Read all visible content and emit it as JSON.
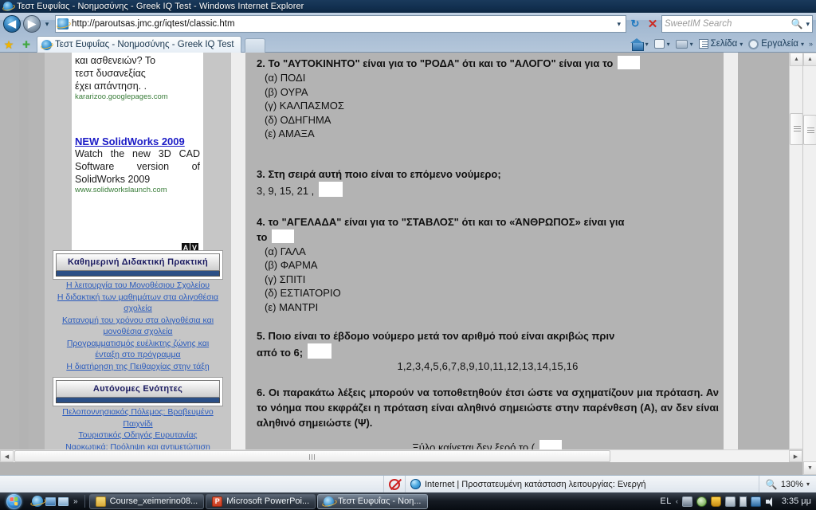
{
  "window": {
    "title": "Τεστ Ευφυΐας - Νοημοσύνης - Greek IQ Test - Windows Internet Explorer",
    "icon": "ie-logo-icon"
  },
  "address_bar": {
    "url": "http://paroutsas.jmc.gr/iqtest/classic.htm",
    "back_label": "◀",
    "forward_label": "▶",
    "history_caret": "▾",
    "go_label": "→",
    "refresh_label": "↻",
    "stop_label": "✕",
    "dropdown_caret": "▾"
  },
  "search": {
    "placeholder": "SweetIM Search",
    "magnifier": "search-icon",
    "caret": "▾"
  },
  "tabs": {
    "favorites_star": "★",
    "add_favorite": "✚",
    "items": [
      {
        "label": "Τεστ Ευφυΐας - Νοημοσύνης - Greek IQ Test",
        "active": true
      }
    ],
    "new_tab_label": ""
  },
  "command_bar": {
    "home": "",
    "feeds": "",
    "print": "",
    "page": "Σελίδα",
    "tools": "Εργαλεία",
    "overflow": "»",
    "caret": "▾"
  },
  "sidebar": {
    "ad": {
      "text_lines": [
        "και ασθενειών? Το",
        "τεστ δυσανεξίας",
        "έχει απάντηση. ."
      ],
      "url1": "kararizoo.googlepages.com",
      "headline": "NEW SolidWorks 2009",
      "description": "Watch the new 3D CAD Software version of SolidWorks 2009",
      "url2": "www.solidworkslaunch.com",
      "badge_a": "A",
      "badge_v": "V"
    },
    "sections": [
      {
        "header": "Καθημερινή Διδακτική  Πρακτική",
        "links": [
          "Η λειτουργία του Μονοθέσιου Σχολείου",
          "Η διδακτική των μαθημάτων στα ολιγοθέσια σχολεία",
          "Κατανομή του χρόνου στα ολιγοθέσια και μονοθέσια σχολεία",
          "Προγραμματισμός ευέλικτης ζώνης και ένταξη στο πρόγραμμα",
          "Η διατήρηση της Πειθαρχίας στην τάξη"
        ]
      },
      {
        "header": "Αυτόνομες  Ενότητες",
        "links": [
          "Πελοποννησιακός Πόλεμος:  Βραβευμένο Παιχνίδι",
          "Τουριστικός Οδηγός Ευρυτανίας",
          "Ναρκωτικά: Πρόληψη και αντιμετώπιση"
        ]
      }
    ]
  },
  "quiz": {
    "questions": [
      {
        "number": "2.",
        "text": "Το \"ΑΥΤΟΚΙΝΗΤΟ\" είναι για το \"ΡΟΔΑ\" ότι και το \"ΑΛΟΓΟ\" είναι για το",
        "answer_value": "",
        "options": [
          "(α) ΠΟΔΙ",
          "(β) ΟΥΡΑ",
          "(γ)  ΚΑΛΠΑΣΜΟΣ",
          "(δ) ΟΔΗΓΗΜΑ",
          "(ε) ΑΜΑΞΑ"
        ]
      },
      {
        "number": "3.",
        "text": "Στη σειρά αυτή ποιο είναι το επόμενο νούμερο;",
        "sequence": "3, 9, 15, 21 ,",
        "answer_value": "",
        "options": []
      },
      {
        "number": "4.",
        "text": "το \"ΑΓΕΛΑΔΑ\" είναι για το \"ΣΤΑΒΛΟΣ\" ότι και το «ΆΝΘΡΩΠΟΣ» είναι για",
        "text_cont": "το",
        "answer_value": "",
        "options": [
          "(α) ΓΑΛΑ",
          "(β) ΦΑΡΜΑ",
          "(γ) ΣΠΙΤΙ",
          "(δ) ΕΣΤΙΑΤΟΡΙΟ",
          "(ε) ΜΑΝΤΡΙ"
        ]
      },
      {
        "number": "5.",
        "text": "Ποιο είναι το έβδομο νούμερο μετά τον αριθμό πού είναι ακριβώς πριν",
        "text_cont": "από το 6;",
        "answer_value": "",
        "number_line": "1,2,3,4,5,6,7,8,9,10,11,12,13,14,15,16",
        "options": []
      },
      {
        "number": "6.",
        "text": "Οι παρακάτω λέξεις μπορούν να τοποθετηθούν έτσι ώστε να σχηματίζουν μια πρόταση. Αν το νόημα που εκφράζει η πρόταση είναι αληθινό σημειώστε στην παρένθεση (Α), αν δεν είναι αληθινό σημειώστε (Ψ).",
        "sentence": "Ξύλο καίγεται δεν ξερό το (",
        "answer_value": "",
        "options": []
      }
    ]
  },
  "status_bar": {
    "blocked_icon": "blocked-popup-icon",
    "zone_icon": "globe-icon",
    "zone_text": "Internet | Προστατευμένη κατάσταση λειτουργίας: Ενεργή",
    "zoom_level": "130%",
    "zoom_caret": "▾"
  },
  "taskbar": {
    "start_label": "",
    "quick_launch_chevron": "»",
    "buttons": [
      {
        "label": "Course_xeimerino08...",
        "icon": "folder-icon",
        "active": false
      },
      {
        "label": "Microsoft PowerPoi...",
        "icon": "powerpoint-icon",
        "active": false
      },
      {
        "label": "Τεστ Ευφυΐας - Νοη...",
        "icon": "ie-logo-icon",
        "active": true
      }
    ],
    "tray": {
      "language": "EL",
      "chevron": "‹",
      "time": "3:35 μμ"
    }
  },
  "colors": {
    "page_background": "#b3b3b3",
    "link": "#2a5bbd",
    "ad_link": "#1b1bc6",
    "ad_url": "#3a7d3a",
    "header_bar": "#2b4f86",
    "title_bar": "#123050"
  }
}
